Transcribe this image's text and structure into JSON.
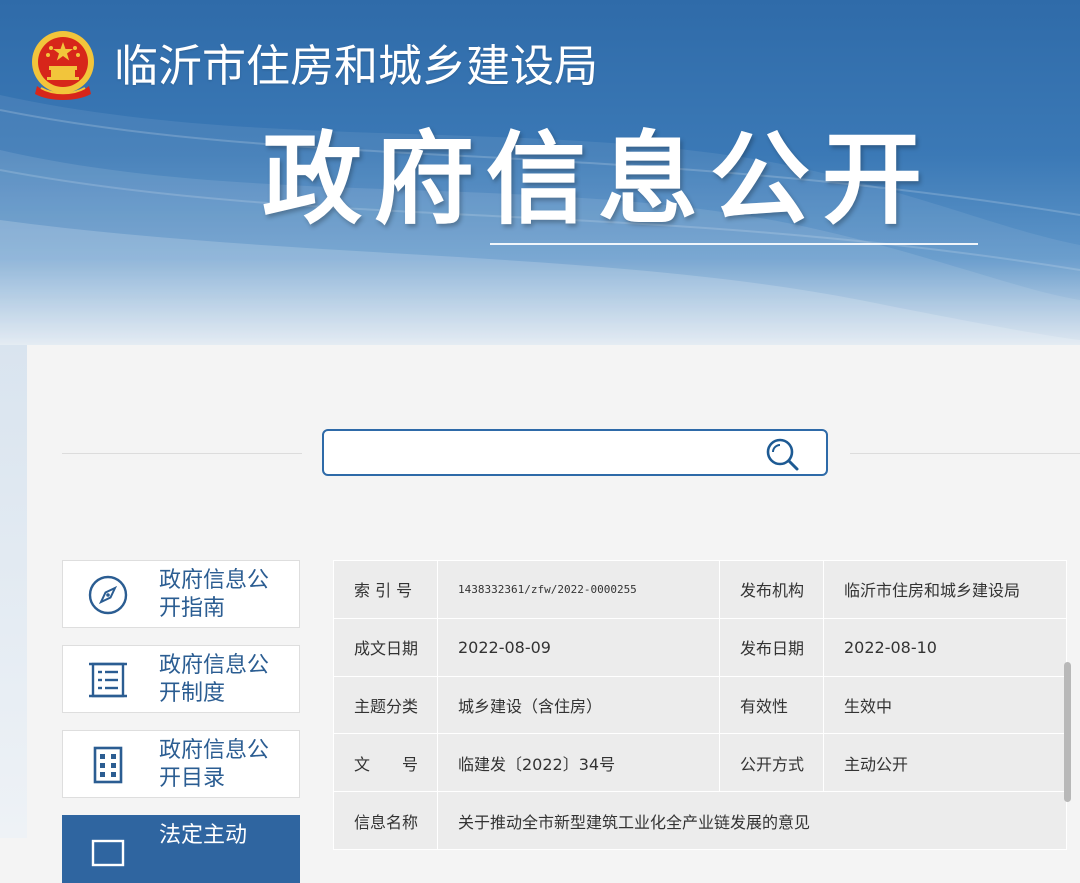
{
  "header": {
    "site_name": "临沂市住房和城乡建设局",
    "banner_title": "政府信息公开"
  },
  "search": {
    "placeholder": ""
  },
  "sidebar": {
    "items": [
      {
        "label": "政府信息公开指南",
        "icon": "compass-icon"
      },
      {
        "label": "政府信息公开制度",
        "icon": "document-list-icon"
      },
      {
        "label": "政府信息公开目录",
        "icon": "building-icon"
      },
      {
        "label": "法定主动",
        "icon": "folder-icon",
        "active": true
      }
    ]
  },
  "meta": {
    "index_no_label": "索 引 号",
    "index_no": "1438332361/zfw/2022-0000255",
    "publisher_label": "发布机构",
    "publisher": "临沂市住房和城乡建设局",
    "created_label": "成文日期",
    "created": "2022-08-09",
    "published_label": "发布日期",
    "published": "2022-08-10",
    "topic_label": "主题分类",
    "topic": "城乡建设（含住房）",
    "validity_label": "有效性",
    "validity": "生效中",
    "docno_label": "文　　号",
    "docno": "临建发〔2022〕34号",
    "disclosure_label": "公开方式",
    "disclosure": "主动公开",
    "title_label": "信息名称",
    "title": "关于推动全市新型建筑工业化全产业链发展的意见"
  },
  "colors": {
    "brand_blue": "#2f6ba9",
    "nav_text": "#2b5d92",
    "active_nav": "#2f65a0",
    "emblem_red": "#d7261a",
    "emblem_gold": "#f2c53b"
  }
}
